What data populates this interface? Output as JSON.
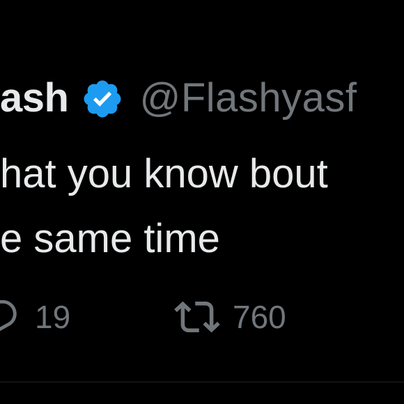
{
  "tweet": {
    "author": {
      "display_name": "ash",
      "handle": "@Flashyasf",
      "verified": true,
      "verified_color": "#1d9bf0",
      "verified_icon": "verified-badge-icon"
    },
    "text_lines": [
      "hat you know bout",
      "e same time"
    ]
  },
  "actions": {
    "reply": {
      "icon": "reply-icon",
      "count": "19"
    },
    "retweet": {
      "icon": "retweet-icon",
      "count": "760"
    },
    "like": {
      "icon": "like-icon"
    }
  },
  "colors": {
    "background": "#000000",
    "primary_text": "#e7e9ea",
    "secondary_text": "#71767b",
    "accent": "#1d9bf0"
  }
}
